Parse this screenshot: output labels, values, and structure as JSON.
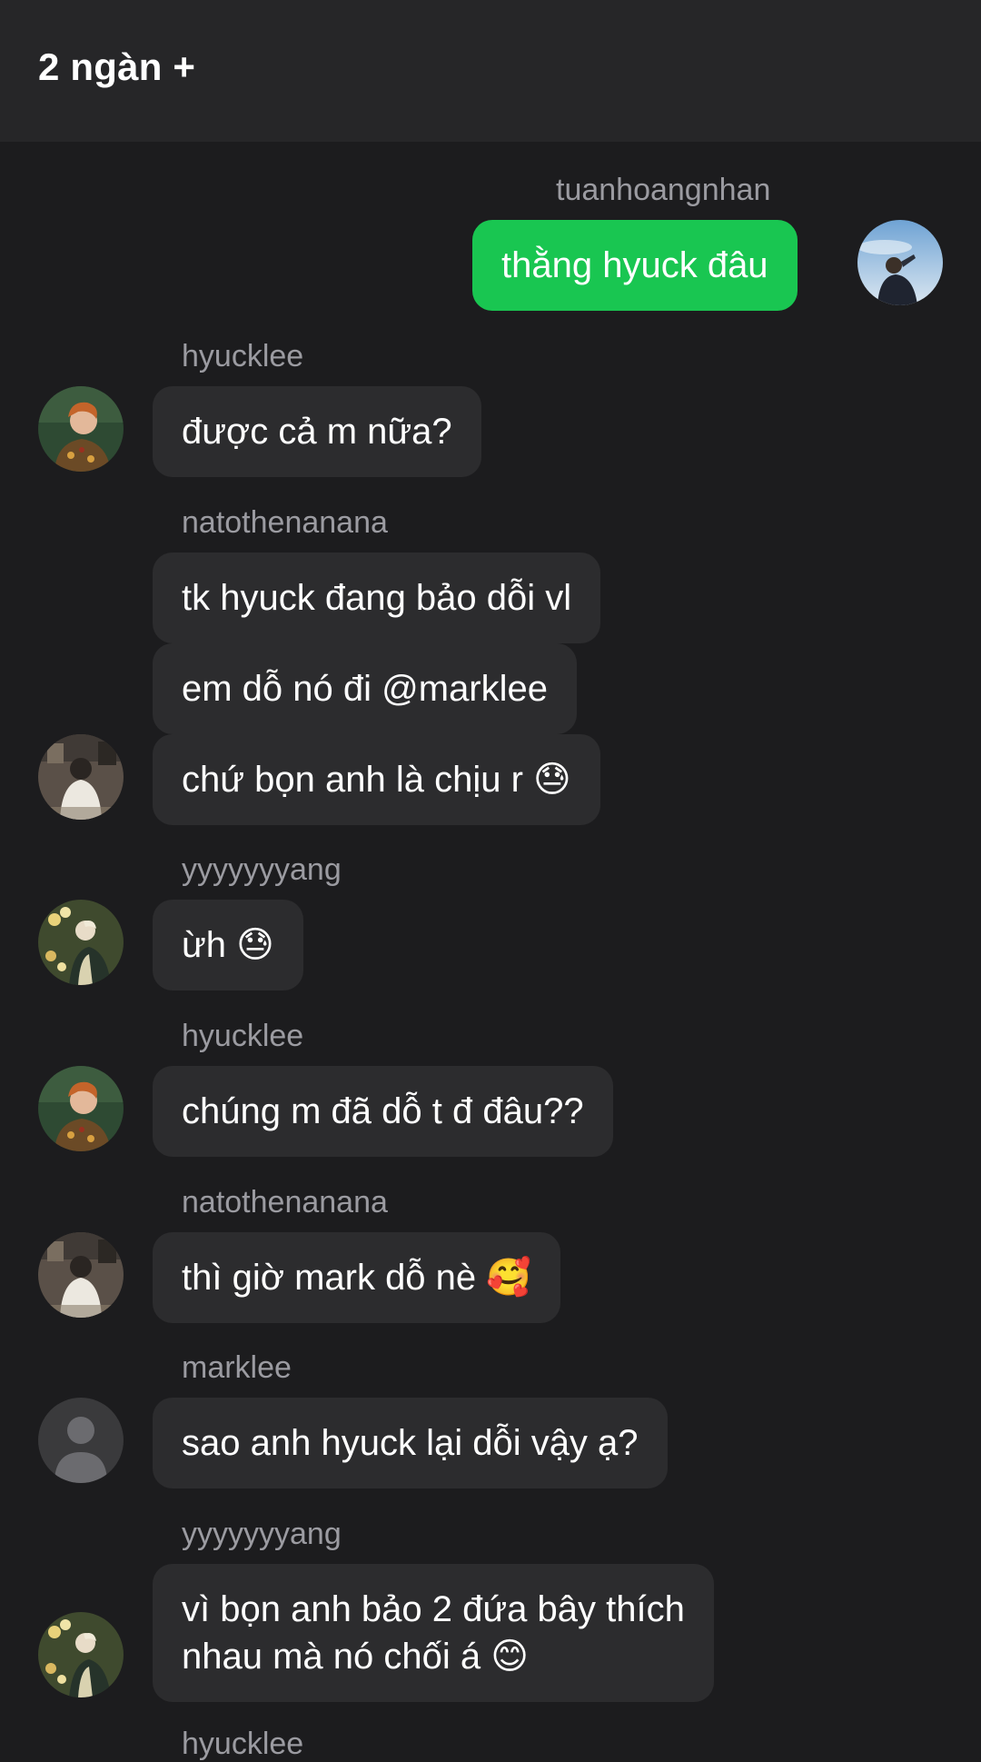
{
  "header": {
    "title": "2 ngàn +"
  },
  "messages": [
    {
      "sender": "tuanhoangnhan",
      "text": "thằng hyuck đâu",
      "mine": true
    },
    {
      "sender": "hyucklee",
      "text": "được cả m nữa?"
    },
    {
      "sender": "natothenanana",
      "text": "tk hyuck đang bảo dỗi vl"
    },
    {
      "text": "em dỗ nó đi @marklee"
    },
    {
      "text": "chứ bọn anh là chịu r 😓"
    },
    {
      "sender": "yyyyyyyang",
      "text": "ừh 😓"
    },
    {
      "sender": "hyucklee",
      "text": "chúng m đã dỗ t đ đâu??"
    },
    {
      "sender": "natothenanana",
      "text": "thì giờ mark dỗ nè 🥰"
    },
    {
      "sender": "marklee",
      "text": "sao anh hyuck lại dỗi vậy ạ?"
    },
    {
      "sender": "yyyyyyyang",
      "text_line1": "vì bọn anh bảo 2 đứa bây thích",
      "text_line2": "nhau mà nó chối á 😊"
    },
    {
      "sender": "hyucklee"
    }
  ],
  "avatars": {
    "tuanhoangnhan": {
      "icon": "sky-portrait-avatar",
      "colors": [
        "#8fb8de",
        "#d6e4f0"
      ]
    },
    "hyucklee": {
      "icon": "orange-hair-portrait-avatar",
      "colors": [
        "#2e4a33",
        "#c4642a"
      ]
    },
    "natothenanana": {
      "icon": "white-coat-portrait-avatar",
      "colors": [
        "#5a5048",
        "#e8e4dc"
      ]
    },
    "yyyyyyyang": {
      "icon": "flowers-portrait-avatar",
      "colors": [
        "#3f4a2e",
        "#d9d2b0"
      ]
    },
    "marklee": {
      "icon": "default-person-avatar",
      "colors": [
        "#3a3a3c",
        "#6b6b6f"
      ]
    }
  },
  "colors": {
    "background": "#1c1c1e",
    "header": "#262628",
    "bubble": "#2c2c2e",
    "bubble_mine": "#19c651",
    "sender_text": "#9b9ba1"
  }
}
